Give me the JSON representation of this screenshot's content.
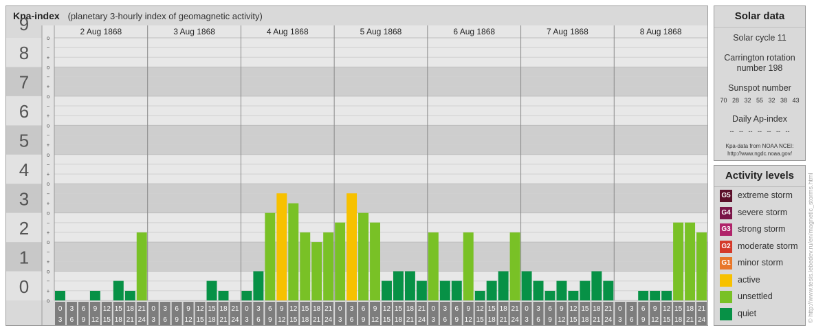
{
  "header": {
    "title": "Kpa-index",
    "subtitle": "(planetary 3-hourly index of geomagnetic activity)"
  },
  "chart_data": {
    "type": "bar",
    "ylim": [
      0,
      9
    ],
    "y_ticks": [
      "0",
      "1",
      "2",
      "3",
      "4",
      "5",
      "6",
      "7",
      "8",
      "9"
    ],
    "sub_ticks": [
      "o",
      "+",
      "−"
    ],
    "days": [
      "2 Aug 1868",
      "3 Aug 1868",
      "4 Aug 1868",
      "5 Aug 1868",
      "6 Aug 1868",
      "7 Aug 1868",
      "8 Aug 1868"
    ],
    "interval_labels": [
      [
        "0",
        "3"
      ],
      [
        "3",
        "6"
      ],
      [
        "6",
        "9"
      ],
      [
        "9",
        "12"
      ],
      [
        "12",
        "15"
      ],
      [
        "15",
        "18"
      ],
      [
        "18",
        "21"
      ],
      [
        "21",
        "24"
      ]
    ],
    "values": [
      [
        0.33,
        0,
        0,
        0.33,
        0,
        0.67,
        0.33,
        2.33
      ],
      [
        0,
        0,
        0,
        0,
        0,
        0.67,
        0.33,
        0
      ],
      [
        0.33,
        1,
        3,
        3.67,
        3.33,
        2.33,
        2,
        2.33
      ],
      [
        2.67,
        3.67,
        3,
        2.67,
        0.67,
        1,
        1,
        0.67
      ],
      [
        2.33,
        0.67,
        0.67,
        2.33,
        0.33,
        0.67,
        1,
        2.33
      ],
      [
        1,
        0.67,
        0.33,
        0.67,
        0.33,
        0.67,
        1,
        0.67
      ],
      [
        0,
        0,
        0.33,
        0.33,
        0.33,
        2.67,
        2.67,
        2.33
      ]
    ],
    "levels": [
      {
        "code": "G5",
        "label": "extreme storm",
        "color": "#5b0f2a"
      },
      {
        "code": "G4",
        "label": "severe storm",
        "color": "#7a1548"
      },
      {
        "code": "G3",
        "label": "strong storm",
        "color": "#b0246a"
      },
      {
        "code": "G2",
        "label": "moderate storm",
        "color": "#d43a2a"
      },
      {
        "code": "G1",
        "label": "minor storm",
        "color": "#e8772a"
      },
      {
        "code": "",
        "label": "active",
        "color": "#f7c100"
      },
      {
        "code": "",
        "label": "unsettled",
        "color": "#79c126"
      },
      {
        "code": "",
        "label": "quiet",
        "color": "#079146"
      }
    ]
  },
  "solar": {
    "title": "Solar data",
    "cycle": "Solar cycle 11",
    "carrington_1": "Carrington rotation",
    "carrington_2": "number 198",
    "sunspot_label": "Sunspot number",
    "sunspot_values": "70   28   32   55   32   38   43",
    "ap_label": "Daily Ap-index",
    "ap_values": "--   --   --   --   --   --   --",
    "source_1": "Kpa-data from NOAA NCEI:",
    "source_2": "http://www.ngdc.noaa.gov/"
  },
  "activity": {
    "title": "Activity levels"
  },
  "watermark": "© http://www.tesis.lebedev.ru/en/magnetic_storms.html"
}
